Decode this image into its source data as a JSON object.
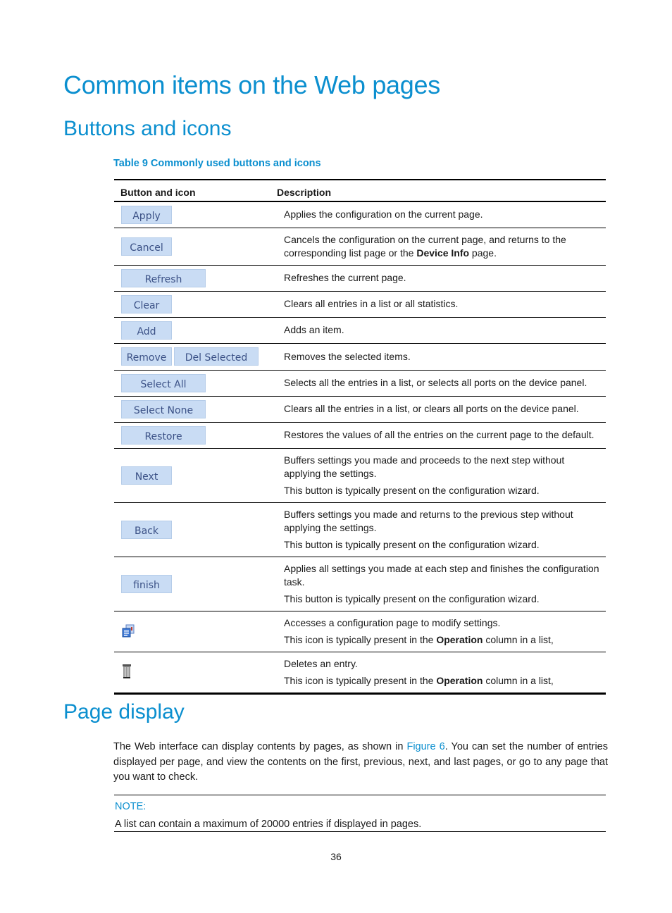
{
  "headings": {
    "title": "Common items on the Web pages",
    "section1": "Buttons and icons",
    "section2": "Page display"
  },
  "table": {
    "caption": "Table 9 Commonly used buttons and icons",
    "headers": [
      "Button and icon",
      "Description"
    ],
    "rows": [
      {
        "buttons": [
          "Apply"
        ],
        "desc": [
          {
            "pre": "Applies the configuration on the current page."
          }
        ]
      },
      {
        "buttons": [
          "Cancel"
        ],
        "desc": [
          {
            "pre": "Cancels the configuration on the current page, and returns to the corresponding list page or the ",
            "bold": "Device Info",
            "post": " page."
          }
        ]
      },
      {
        "buttons": [
          "Refresh"
        ],
        "desc": [
          {
            "pre": "Refreshes the current page."
          }
        ]
      },
      {
        "buttons": [
          "Clear"
        ],
        "desc": [
          {
            "pre": "Clears all entries in a list or all statistics."
          }
        ]
      },
      {
        "buttons": [
          "Add"
        ],
        "desc": [
          {
            "pre": "Adds an item."
          }
        ]
      },
      {
        "buttons": [
          "Remove",
          "Del Selected"
        ],
        "desc": [
          {
            "pre": "Removes the selected items."
          }
        ]
      },
      {
        "buttons": [
          "Select All"
        ],
        "desc": [
          {
            "pre": "Selects all the entries in a list, or selects all ports on the device panel."
          }
        ]
      },
      {
        "buttons": [
          "Select None"
        ],
        "desc": [
          {
            "pre": "Clears all the entries in a list, or clears all ports on the device panel."
          }
        ]
      },
      {
        "buttons": [
          "Restore"
        ],
        "desc": [
          {
            "pre": "Restores the values of all the entries on the current page to the default."
          }
        ]
      },
      {
        "buttons": [
          "Next"
        ],
        "desc": [
          {
            "pre": "Buffers settings you made and proceeds to the next step without applying the settings."
          },
          {
            "pre": "This button is typically present on the configuration wizard."
          }
        ]
      },
      {
        "buttons": [
          "Back"
        ],
        "desc": [
          {
            "pre": "Buffers settings you made and returns to the previous step without applying the settings."
          },
          {
            "pre": "This button is typically present on the configuration wizard."
          }
        ]
      },
      {
        "buttons": [
          "finish"
        ],
        "desc": [
          {
            "pre": "Applies all settings you made at each step and finishes the configuration task."
          },
          {
            "pre": "This button is typically present on the configuration wizard."
          }
        ]
      },
      {
        "icon": "edit-config-icon",
        "desc": [
          {
            "pre": "Accesses a configuration page to modify settings."
          },
          {
            "pre": "This icon is typically present in the ",
            "bold": "Operation",
            "post": " column in a list,"
          }
        ]
      },
      {
        "icon": "trash-icon",
        "desc": [
          {
            "pre": "Deletes an entry."
          },
          {
            "pre": "This icon is typically present in the ",
            "bold": "Operation",
            "post": " column in a list,"
          }
        ]
      }
    ]
  },
  "page_display": {
    "para_pre": "The Web interface can display contents by pages, as shown in ",
    "link": "Figure 6",
    "para_post": ". You can set the number of entries displayed per page, and view the contents on the first, previous, next, and last pages, or go to any page that you want to check."
  },
  "note": {
    "label": "NOTE:",
    "text": "A list can contain a maximum of 20000 entries if displayed in pages."
  },
  "page_number": "36",
  "colors": {
    "heading": "#0b8fcf",
    "button_fill": "#c9dcf4",
    "button_text": "#3b5186"
  }
}
